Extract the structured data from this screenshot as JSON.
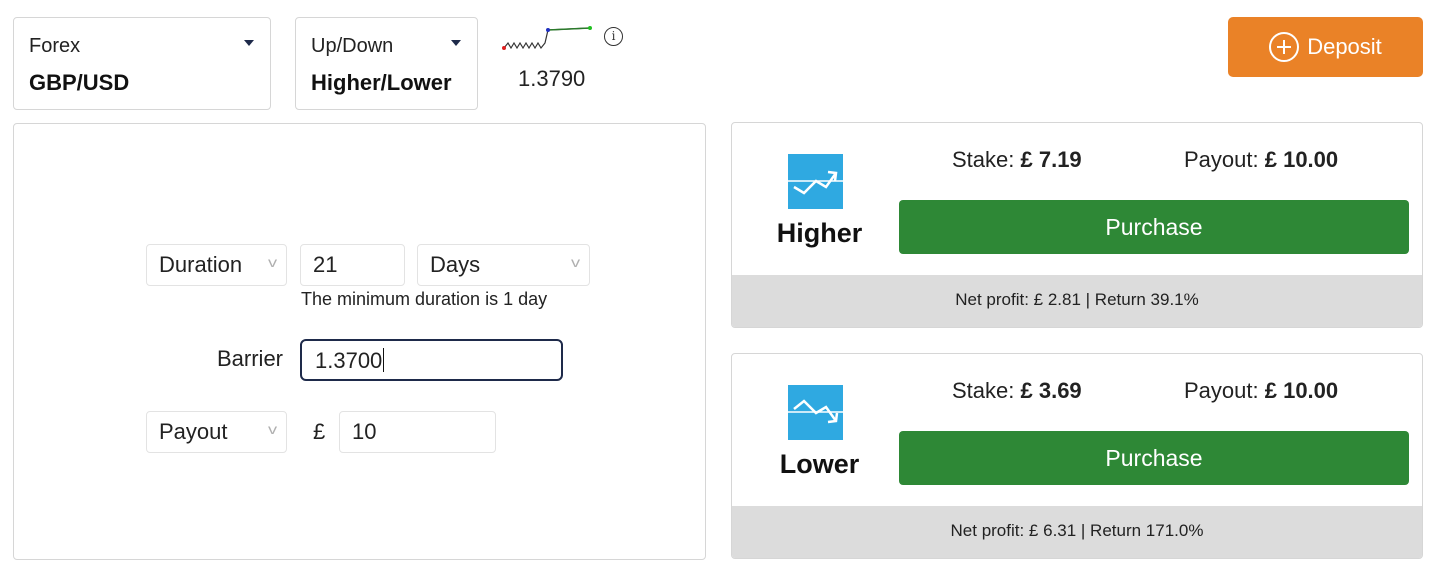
{
  "market": {
    "category": "Forex",
    "symbol": "GBP/USD"
  },
  "trade_type": {
    "category": "Up/Down",
    "type": "Higher/Lower"
  },
  "spot": {
    "price": "1.3790",
    "info_icon": "info-icon"
  },
  "deposit": {
    "label": "Deposit",
    "icon": "plus-circle-icon"
  },
  "form": {
    "duration": {
      "type": "Duration",
      "value": "21",
      "unit": "Days",
      "hint": "The minimum duration is 1 day"
    },
    "barrier": {
      "label": "Barrier",
      "value": "1.3700"
    },
    "payout": {
      "type": "Payout",
      "currency": "£",
      "amount": "10"
    }
  },
  "contracts": [
    {
      "label": "Higher",
      "icon": "higher-trend-icon",
      "stake_label": "Stake:",
      "stake": "£ 7.19",
      "payout_label": "Payout:",
      "payout": "£ 10.00",
      "purchase_label": "Purchase",
      "footer": "Net profit: £ 2.81 | Return 39.1%"
    },
    {
      "label": "Lower",
      "icon": "lower-trend-icon",
      "stake_label": "Stake:",
      "stake": "£ 3.69",
      "payout_label": "Payout:",
      "payout": "£ 10.00",
      "purchase_label": "Purchase",
      "footer": "Net profit: £ 6.31 | Return 171.0%"
    }
  ],
  "colors": {
    "deposit": "#ea8227",
    "purchase": "#2e8836",
    "contract_icon": "#2fa9e1",
    "footer_bg": "#dcdcdc",
    "barrier_border": "#1e2a4a"
  }
}
